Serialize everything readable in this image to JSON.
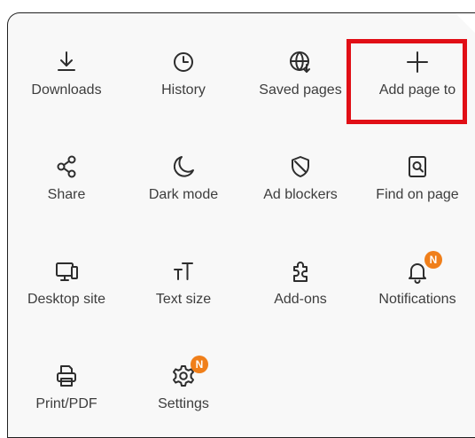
{
  "menu": {
    "items": [
      {
        "id": "downloads",
        "label": "Downloads",
        "icon": "download-icon"
      },
      {
        "id": "history",
        "label": "History",
        "icon": "clock-icon"
      },
      {
        "id": "saved-pages",
        "label": "Saved pages",
        "icon": "saved-pages-icon"
      },
      {
        "id": "add-page-to",
        "label": "Add page to",
        "icon": "plus-icon"
      },
      {
        "id": "share",
        "label": "Share",
        "icon": "share-icon"
      },
      {
        "id": "dark-mode",
        "label": "Dark mode",
        "icon": "moon-icon"
      },
      {
        "id": "ad-blockers",
        "label": "Ad blockers",
        "icon": "shield-icon"
      },
      {
        "id": "find-on-page",
        "label": "Find on page",
        "icon": "find-on-page-icon"
      },
      {
        "id": "desktop-site",
        "label": "Desktop site",
        "icon": "desktop-icon"
      },
      {
        "id": "text-size",
        "label": "Text size",
        "icon": "text-size-icon"
      },
      {
        "id": "add-ons",
        "label": "Add-ons",
        "icon": "puzzle-icon"
      },
      {
        "id": "notifications",
        "label": "Notifications",
        "icon": "bell-icon",
        "badge": "N"
      },
      {
        "id": "print-pdf",
        "label": "Print/PDF",
        "icon": "printer-icon"
      },
      {
        "id": "settings",
        "label": "Settings",
        "icon": "gear-icon",
        "badge": "N"
      }
    ]
  },
  "colors": {
    "badge": "#f07f1a",
    "highlight": "#e10f16",
    "icon": "#2d2d2d",
    "label": "#3d3d3d",
    "panel": "#f8f8f8"
  }
}
